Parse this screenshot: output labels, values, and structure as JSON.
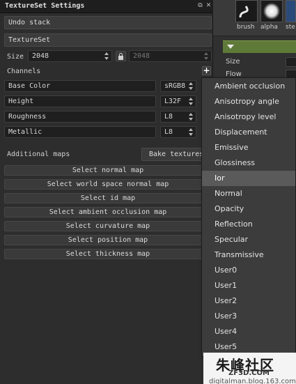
{
  "panel": {
    "title": "TextureSet Settings",
    "undo_stack": "Undo stack",
    "textureset": "TextureSet",
    "size_label": "Size",
    "size_value": "2048",
    "size_value_locked": "2048",
    "channels_label": "Channels",
    "channels": [
      {
        "name": "Base Color",
        "format": "sRGB8"
      },
      {
        "name": "Height",
        "format": "L32F"
      },
      {
        "name": "Roughness",
        "format": "L8"
      },
      {
        "name": "Metallic",
        "format": "L8"
      }
    ],
    "additional_maps_label": "Additional maps",
    "bake_button": "Bake textures",
    "map_buttons": [
      "Select normal map",
      "Select world space normal map",
      "Select id map",
      "Select ambient occlusion map",
      "Select curvature map",
      "Select position map",
      "Select thickness map"
    ]
  },
  "right_panel": {
    "brush_label": "brush",
    "alpha_label": "alpha",
    "stencil_label": "ste",
    "rows": [
      "Size",
      "Flow"
    ]
  },
  "dropdown": {
    "items": [
      "Ambient occlusion",
      "Anisotropy angle",
      "Anisotropy level",
      "Displacement",
      "Emissive",
      "Glossiness",
      "Ior",
      "Normal",
      "Opacity",
      "Reflection",
      "Specular",
      "Transmissive",
      "User0",
      "User1",
      "User2",
      "User3",
      "User4",
      "User5"
    ],
    "highlighted": "Ior"
  },
  "watermark": {
    "main": "朱峰社区",
    "site": "ZF3D.COM",
    "sub": "digitalman.blog.163.com"
  },
  "colors": {
    "panel_bg": "#2d2d2d",
    "field_bg": "#1f1f1f",
    "accent_green": "#5f7a38",
    "dropdown_bg": "#3c3c3c",
    "highlight_bg": "#5a5a5a"
  }
}
